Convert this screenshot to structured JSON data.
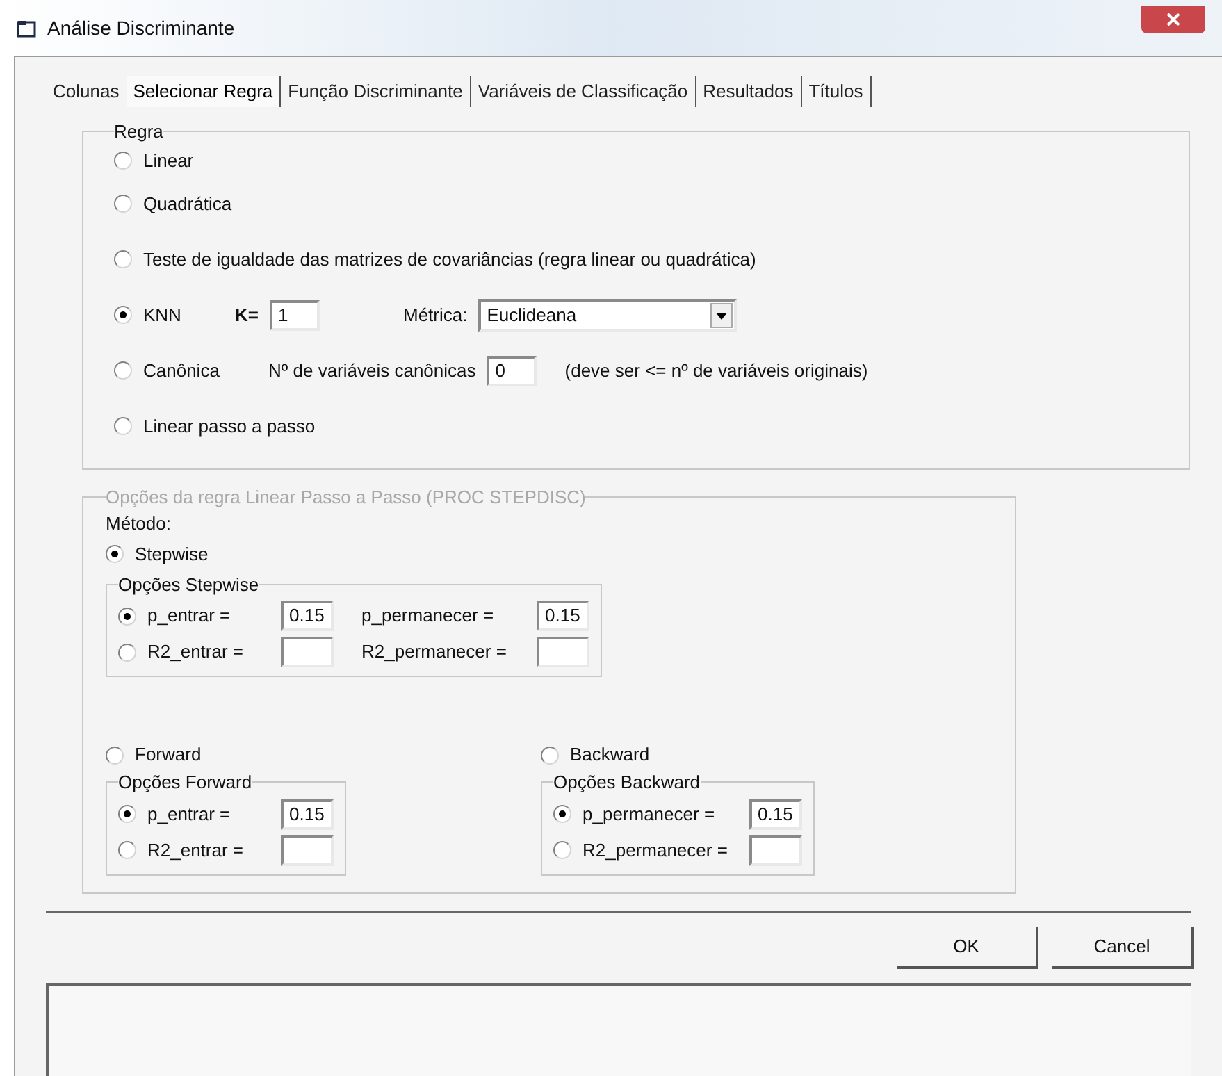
{
  "window": {
    "title": "Análise Discriminante"
  },
  "tabs": [
    {
      "label": "Colunas",
      "selected": false
    },
    {
      "label": "Selecionar Regra",
      "selected": true
    },
    {
      "label": "Função Discriminante",
      "selected": false
    },
    {
      "label": "Variáveis de Classificação",
      "selected": false
    },
    {
      "label": "Resultados",
      "selected": false
    },
    {
      "label": "Títulos",
      "selected": false
    }
  ],
  "rule_group": {
    "title": "Regra",
    "options": [
      {
        "kind": "plain",
        "label": "Linear",
        "selected": false
      },
      {
        "kind": "plain",
        "label": "Quadrática",
        "selected": false
      },
      {
        "kind": "plain",
        "label": "Teste de igualdade das matrizes de covariâncias (regra linear ou quadrática)",
        "selected": false
      },
      {
        "kind": "knn",
        "label": "KNN",
        "selected": true,
        "k_label": "K=",
        "k_value": "1",
        "metric_label": "Métrica:",
        "metric_value": "Euclideana"
      },
      {
        "kind": "canonical",
        "label": "Canônica",
        "selected": false,
        "count_label": "Nº de variáveis canônicas",
        "count_value": "0",
        "note": "(deve ser <= nº de variáveis originais)"
      },
      {
        "kind": "plain",
        "label": "Linear passo a passo",
        "selected": false
      }
    ]
  },
  "step_group": {
    "title": "Opções da regra Linear Passo a Passo (PROC STEPDISC)",
    "disabled": true,
    "method_label": "Método:",
    "stepwise": {
      "label": "Stepwise",
      "selected": true,
      "options": {
        "title": "Opções Stepwise",
        "rows": [
          {
            "label": "p_entrar =",
            "selected": true,
            "value": "0.15",
            "second_label": "p_permanecer =",
            "second_value": "0.15"
          },
          {
            "label": "R2_entrar =",
            "selected": false,
            "second_label": "R2_permanecer ="
          }
        ]
      }
    },
    "methods": [
      {
        "label": "Forward",
        "selected": false,
        "options": {
          "title": "Opções Forward",
          "rows": [
            {
              "label": "p_entrar =",
              "selected": true,
              "value": "0.15"
            },
            {
              "label": "R2_entrar =",
              "selected": false
            }
          ]
        }
      },
      {
        "label": "Backward",
        "selected": false,
        "options": {
          "title": "Opções Backward",
          "rows": [
            {
              "label": "p_permanecer =",
              "selected": true,
              "value": "0.15"
            },
            {
              "label": "R2_permanecer =",
              "selected": false
            }
          ]
        }
      }
    ]
  },
  "buttons": [
    "OK",
    "Cancel"
  ]
}
